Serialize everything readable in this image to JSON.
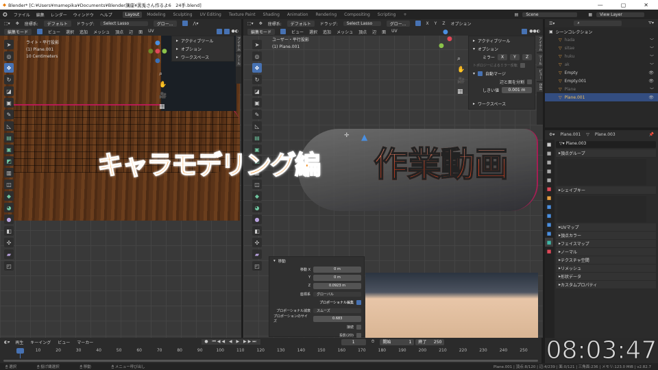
{
  "window": {
    "title": "Blender* [C:¥Users¥mamepika¥Documents¥Blender講座¥黒兎さん作るよ6　24手.blend]",
    "minimize": "—",
    "maximize": "▢",
    "close": "✕"
  },
  "menu": {
    "items": [
      "ファイル",
      "編集",
      "レンダー",
      "ウィンドウ",
      "ヘルプ"
    ],
    "workspaces": [
      "Layout",
      "Modeling",
      "Sculpting",
      "UV Editing",
      "Texture Paint",
      "Shading",
      "Animation",
      "Rendering",
      "Compositing",
      "Scripting",
      "+"
    ],
    "active_workspace": "Layout",
    "scene": "Scene",
    "view_layer": "View Layer"
  },
  "tool_header": {
    "coord_label": "座標系:",
    "pivot": "デフォルト",
    "drag_label": "ドラッグ:",
    "drag_value": "Select Lasso",
    "orientation": "グロー...",
    "options": "オプション",
    "xyz": [
      "X",
      "Y",
      "Z"
    ]
  },
  "editor_header": {
    "mode": "編集モード",
    "menus": [
      "ビュー",
      "選択",
      "追加",
      "メッシュ",
      "頂点",
      "辺",
      "面",
      "UV"
    ]
  },
  "left_viewport": {
    "view_name": "ライト・平行投影",
    "object": "(1) Plane.001",
    "scale": "10 Centimeters",
    "popup": [
      "アクティブツール",
      "オプション",
      "ワークスペース"
    ],
    "side_tabs": [
      "アイテム",
      "ツール"
    ]
  },
  "right_viewport": {
    "view_name": "ユーザー・平行投影",
    "object": "(1) Plane.001",
    "side_tabs": [
      "アイテム",
      "ツール",
      "ビュー",
      "Edit"
    ]
  },
  "tools": [
    {
      "icon": "cursor",
      "g": "➤"
    },
    {
      "icon": "cursor-3d",
      "g": "◎"
    },
    {
      "icon": "move",
      "g": "✥",
      "active": true
    },
    {
      "icon": "rotate",
      "g": "↻"
    },
    {
      "icon": "scale",
      "g": "◪"
    },
    {
      "icon": "transform",
      "g": "▣"
    },
    {
      "icon": "annotate",
      "g": "✎"
    },
    {
      "icon": "measure",
      "g": "◺"
    },
    {
      "icon": "extrude",
      "g": "▤",
      "c": "green"
    },
    {
      "icon": "inset",
      "g": "▣",
      "c": "green"
    },
    {
      "icon": "bevel",
      "g": "◩",
      "c": "green"
    },
    {
      "icon": "loop-cut",
      "g": "▥"
    },
    {
      "icon": "knife",
      "g": "◫"
    },
    {
      "icon": "poly-build",
      "g": "◆",
      "c": "green"
    },
    {
      "icon": "spin",
      "g": "◕",
      "c": "green"
    },
    {
      "icon": "smooth",
      "g": "●",
      "c": "purple"
    },
    {
      "icon": "edge-slide",
      "g": "◧"
    },
    {
      "icon": "shrink",
      "g": "✣"
    },
    {
      "icon": "shear",
      "g": "▰",
      "c": "purple"
    },
    {
      "icon": "rip",
      "g": "◰"
    }
  ],
  "n_panel": {
    "active_tool": "アクティブツール",
    "options": "オプション",
    "mirror_label": "ミラー",
    "mirror_axes": [
      "X",
      "Y",
      "Z"
    ],
    "topology_mirror": "トポロジーによるミラー反転",
    "auto_merge": "自動マージ",
    "split_edges": "辺と面を分割",
    "threshold_label": "しきい値",
    "threshold_value": "0.001 m",
    "workspace": "ワークスペース"
  },
  "operator_panel": {
    "title": "移動",
    "rows": [
      {
        "label": "移動 X",
        "value": "0 m"
      },
      {
        "label": "Y",
        "value": "0 m"
      },
      {
        "label": "Z",
        "value": "0.0923 m"
      }
    ],
    "orient_label": "座標系",
    "orient_value": "グローバル",
    "prop_edit": "プロポーショナル編集",
    "falloff_label": "プロポーショナル減衰",
    "falloff_value": "スムーズ",
    "size_label": "プロポーションのサイズ",
    "size_value": "0.683",
    "connected": "接続",
    "projected": "投影(2D)"
  },
  "overlay_text": {
    "line1": "キャラモデリング編",
    "line2": "作業動画"
  },
  "outliner": {
    "root": "シーンコレクション",
    "items": [
      {
        "name": "hada",
        "dim": true,
        "eye": "﹀"
      },
      {
        "name": "sitae",
        "dim": true,
        "eye": "﹀"
      },
      {
        "name": "huku",
        "dim": true,
        "eye": "﹀"
      },
      {
        "name": "ak",
        "dim": true,
        "eye": "﹀"
      },
      {
        "name": "Empty",
        "eye": "👁"
      },
      {
        "name": "Empty.001",
        "eye": "👁"
      },
      {
        "name": "Plane",
        "dim": true,
        "eye": "﹀"
      },
      {
        "name": "Plane.001",
        "selected": true,
        "eye": "👁"
      }
    ]
  },
  "properties": {
    "object": "Plane.001",
    "mesh": "Plane.003",
    "datablock": "Plane.003",
    "sections": [
      "頂点グループ",
      "シェイプキー",
      "UVマップ",
      "頂点カラー",
      "フェイスマップ",
      "ノーマル",
      "テクスチャ空間",
      "リメッシュ",
      "形状データ",
      "カスタムプロパティ"
    ],
    "tabs": [
      "tool",
      "render",
      "output",
      "view-layer",
      "scene",
      "world",
      "object",
      "modifier",
      "particles",
      "physics",
      "constraints",
      "data",
      "material"
    ]
  },
  "timeline": {
    "menus": [
      "再生",
      "キーイング",
      "ビュー",
      "マーカー"
    ],
    "current_frame": "1",
    "start_label": "開始",
    "start": "1",
    "end_label": "終了",
    "end": "250",
    "ticks": [
      "1",
      "10",
      "20",
      "30",
      "40",
      "50",
      "60",
      "70",
      "80",
      "90",
      "100",
      "110",
      "120",
      "130",
      "140",
      "150",
      "160",
      "170",
      "180",
      "190",
      "200",
      "210",
      "220",
      "230",
      "240",
      "250"
    ]
  },
  "clock": "08:03:47",
  "status": {
    "left": [
      "選択",
      "投げ縄選択",
      "移動",
      "メニュー呼び出し"
    ],
    "right": "Plane.001 | 頂点:8/120 | 辺:4/239 | 面:0/121 | 三角面:236 | メモリ:123.0 MiB | v2.82.7"
  },
  "colors": {
    "accent": "#4772b3",
    "selection": "#334d80",
    "overlay_orange": "#f08a1a",
    "overlay_red": "#e5532a"
  }
}
